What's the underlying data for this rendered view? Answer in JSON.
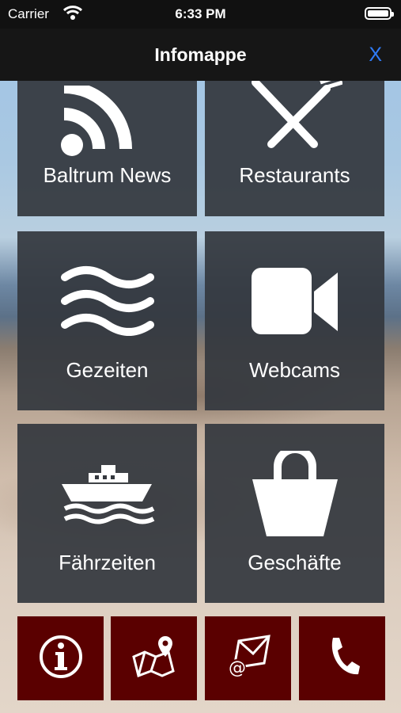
{
  "status": {
    "carrier": "Carrier",
    "time": "6:33 PM"
  },
  "nav": {
    "title": "Infomappe",
    "close": "X"
  },
  "tiles": [
    {
      "label": "Baltrum News",
      "icon": "rss-icon"
    },
    {
      "label": "Restaurants",
      "icon": "fork-knife-icon"
    },
    {
      "label": "Gezeiten",
      "icon": "waves-icon"
    },
    {
      "label": "Webcams",
      "icon": "video-camera-icon"
    },
    {
      "label": "Fährzeiten",
      "icon": "ferry-icon"
    },
    {
      "label": "Geschäfte",
      "icon": "shopping-bag-icon"
    }
  ],
  "bottom_buttons": [
    {
      "icon": "info-icon"
    },
    {
      "icon": "map-icon"
    },
    {
      "icon": "email-icon"
    },
    {
      "icon": "phone-icon"
    }
  ],
  "colors": {
    "tile": "#34383e",
    "bottom_button": "#5a0000",
    "nav_bar": "#161616",
    "close_accent": "#2f7bf6"
  }
}
